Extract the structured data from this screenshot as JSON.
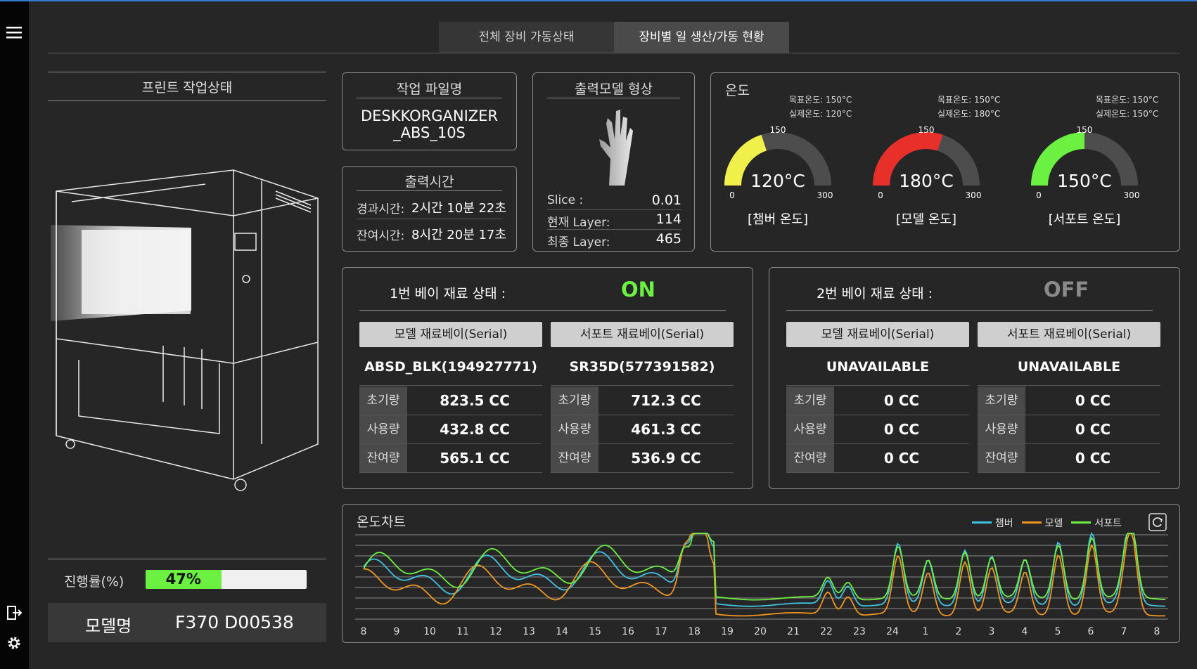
{
  "tabs": [
    "전체 장비 가동상태",
    "장비별 일 생산/가동 현황"
  ],
  "print_status": {
    "title": "프린트 작업상태",
    "progress_label": "진행률(%)",
    "progress_value": 47,
    "progress_text": "47%",
    "model_label": "모델명",
    "model_value": "F370 D00538"
  },
  "job_file": {
    "title": "작업 파일명",
    "line1": "DESKKORGANIZER",
    "line2": "_ABS_10S"
  },
  "print_time": {
    "title": "출력시간",
    "elapsed_label": "경과시간:",
    "elapsed_value": "2시간 10분 22초",
    "remaining_label": "잔여시간:",
    "remaining_value": "8시간 20분 17초"
  },
  "model_shape": {
    "title": "출력모델 형상",
    "rows": [
      {
        "label": "Slice :",
        "value": "0.01"
      },
      {
        "label": "현재 Layer:",
        "value": "114"
      },
      {
        "label": "최종 Layer:",
        "value": "465"
      }
    ]
  },
  "temperature": {
    "title": "온도",
    "gauges": [
      {
        "target": "목표온도: 150°C",
        "actual": "실제온도: 120°C",
        "value": 120,
        "value_text": "120°C",
        "max_tick": "150",
        "min": "0",
        "max": "300",
        "label": "[챔버 온도]",
        "color": "#f0f04a"
      },
      {
        "target": "목표온도: 150°C",
        "actual": "실제온도: 180°C",
        "value": 180,
        "value_text": "180°C",
        "max_tick": "150",
        "min": "0",
        "max": "300",
        "label": "[모델 온도]",
        "color": "#e8302a"
      },
      {
        "target": "목표온도: 150°C",
        "actual": "실제온도: 150°C",
        "value": 150,
        "value_text": "150°C",
        "max_tick": "150",
        "min": "0",
        "max": "300",
        "label": "[서포트 온도]",
        "color": "#6cf041"
      }
    ]
  },
  "bay1": {
    "title": "1번 베이 재료 상태 :",
    "status": "ON",
    "status_color": "#6cf041",
    "columns": [
      {
        "header": "모델 재료베이(Serial)",
        "serial": "ABSD_BLK(194927771)",
        "rows": [
          {
            "k": "초기량",
            "v": "823.5 CC"
          },
          {
            "k": "사용량",
            "v": "432.8 CC"
          },
          {
            "k": "잔여량",
            "v": "565.1 CC"
          }
        ]
      },
      {
        "header": "서포트 재료베이(Serial)",
        "serial": "SR35D(577391582)",
        "rows": [
          {
            "k": "초기량",
            "v": "712.3 CC"
          },
          {
            "k": "사용량",
            "v": "461.3 CC"
          },
          {
            "k": "잔여량",
            "v": "536.9 CC"
          }
        ]
      }
    ]
  },
  "bay2": {
    "title": "2번 베이 재료 상태 :",
    "status": "OFF",
    "status_color": "#8a8a8a",
    "columns": [
      {
        "header": "모델 재료베이(Serial)",
        "serial": "UNAVAILABLE",
        "rows": [
          {
            "k": "초기량",
            "v": "0 CC"
          },
          {
            "k": "사용량",
            "v": "0 CC"
          },
          {
            "k": "잔여량",
            "v": "0 CC"
          }
        ]
      },
      {
        "header": "서포트 재료베이(Serial)",
        "serial": "UNAVAILABLE",
        "rows": [
          {
            "k": "초기량",
            "v": "0 CC"
          },
          {
            "k": "사용량",
            "v": "0 CC"
          },
          {
            "k": "잔여량",
            "v": "0 CC"
          }
        ]
      }
    ]
  },
  "chart_data": {
    "type": "line",
    "title": "온도차트",
    "x": [
      "8",
      "9",
      "10",
      "11",
      "12",
      "13",
      "14",
      "15",
      "16",
      "17",
      "18",
      "19",
      "20",
      "21",
      "22",
      "23",
      "24",
      "1",
      "2",
      "3",
      "4",
      "5",
      "6",
      "7",
      "8"
    ],
    "grid": true,
    "legend_position": "top-right",
    "series": [
      {
        "name": "챔버",
        "color": "#3ec3e0"
      },
      {
        "name": "모델",
        "color": "#f0961e"
      },
      {
        "name": "서포트",
        "color": "#6cf041"
      }
    ]
  },
  "icons": {
    "menu": "menu-icon",
    "logout": "logout-icon",
    "settings": "gear-icon",
    "refresh": "refresh-icon"
  }
}
